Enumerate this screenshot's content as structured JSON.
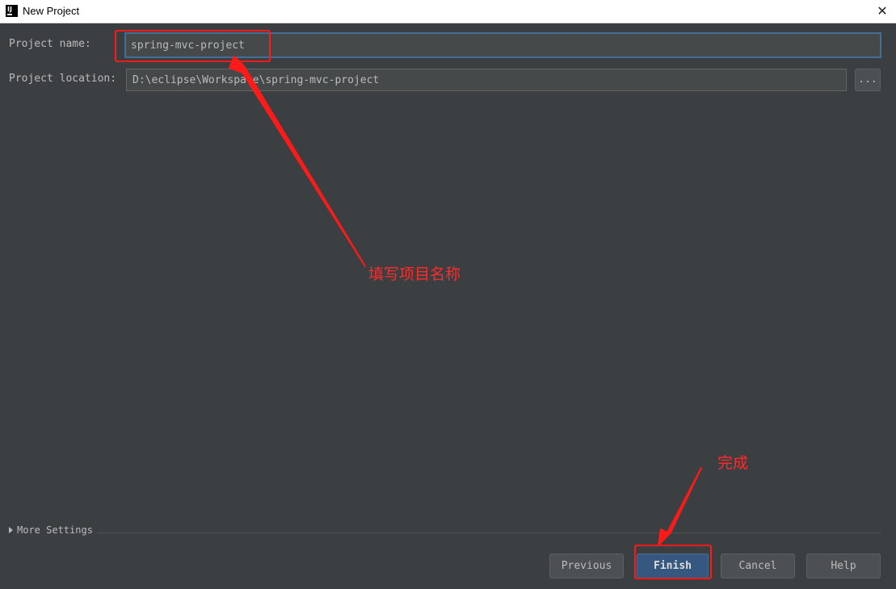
{
  "window": {
    "title": "New Project",
    "app_icon_text": "IJ",
    "close_glyph": "✕"
  },
  "form": {
    "project_name_label": "Project name:",
    "project_name_value": "spring-mvc-project",
    "project_location_label": "Project location:",
    "project_location_value": "D:\\eclipse\\Workspace\\spring-mvc-project",
    "browse_label": "..."
  },
  "more_settings": {
    "label": "More Settings"
  },
  "buttons": {
    "previous": "Previous",
    "finish": "Finish",
    "cancel": "Cancel",
    "help": "Help"
  },
  "annotations": {
    "name_note": "填写项目名称",
    "finish_note": "完成",
    "color": "#ff2a2a"
  },
  "colors": {
    "dialog_background": "#3c3f41",
    "field_background": "#45494a",
    "focus_border": "#466d94",
    "primary_button": "#365880"
  }
}
